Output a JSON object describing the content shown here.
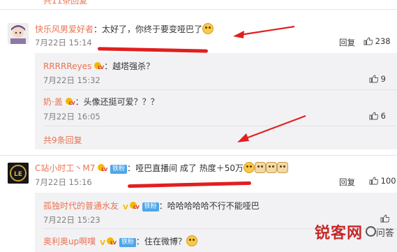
{
  "top_stub": {
    "text": "共11条回复"
  },
  "comments": [
    {
      "user": "快乐风男爱好者",
      "sep": "：",
      "text": "太好了，你终于要变哑巴了",
      "time": "7月22日 15:14",
      "reply_label": "回复",
      "likes": "238"
    },
    {
      "user": "C站小时工丶M7",
      "fan_badge": "铁粉",
      "sep": "：",
      "text": "哑巴直播间 成了 热度＋50万",
      "time": "7月22日 15:16",
      "reply_label": "回复",
      "likes": "100"
    }
  ],
  "replies_1": [
    {
      "user": "RRRRReyes",
      "sep": "：",
      "text": "越塔强杀？",
      "time": "7月22日 15:32",
      "likes": "9"
    },
    {
      "user": "奶·盖",
      "sep": "：",
      "text": "头像还挺可爱？？？",
      "time": "7月22日 16:05",
      "likes": "6"
    }
  ],
  "more_replies_1": "共9条回复",
  "replies_2": [
    {
      "user": "孤独时代的普通水友",
      "fan_badge": "铁粉",
      "sep": "：",
      "text": "哈哈哈哈哈不行不能哑巴",
      "time": "7月22日 15:23",
      "likes": ""
    },
    {
      "user": "奥利奥up啊噗",
      "fan_badge": "铁粉",
      "sep": "：",
      "text": "住在微博？",
      "time": "",
      "likes": ""
    }
  ],
  "watermark": {
    "brand": "锐客网",
    "suffix": "问答"
  },
  "icons": {
    "thumb": "thumbs-up-icon",
    "vip": "vip-v-icon",
    "level": "level-badge-icon",
    "emoji": "emoji-icon"
  },
  "colors": {
    "nickname": "#eb7350",
    "muted": "#808080",
    "reply_bg": "#f2f2f5",
    "annotation_red": "#e11f1f",
    "fan_badge": "#4fa6e8"
  }
}
